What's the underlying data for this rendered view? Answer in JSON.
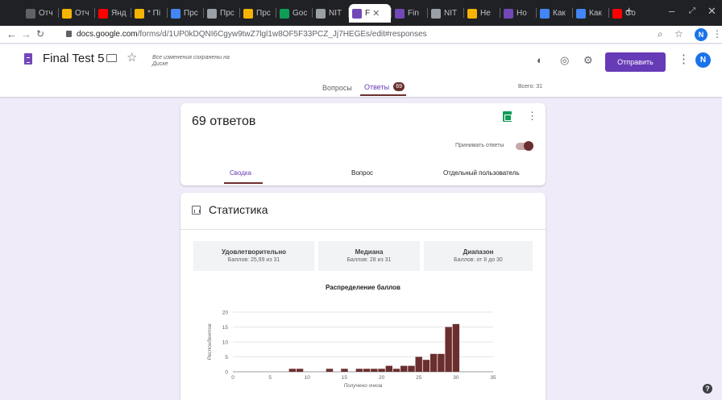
{
  "browser": {
    "tabs": [
      {
        "title": "Отч",
        "color": "#5f6368",
        "icon": "doc-icon"
      },
      {
        "title": "Отч",
        "color": "#f4b400",
        "icon": "slides-icon"
      },
      {
        "title": "Янд",
        "color": "#ff0000",
        "icon": "yandex-icon"
      },
      {
        "title": "* Пі",
        "color": "#f4b400",
        "icon": "mail-icon"
      },
      {
        "title": "Прс",
        "color": "#4285f4",
        "icon": "doc-icon"
      },
      {
        "title": "Прс",
        "color": "#9aa0a6",
        "icon": "app-icon"
      },
      {
        "title": "Прс",
        "color": "#f4b400",
        "icon": "slides-icon"
      },
      {
        "title": "Goc",
        "color": "#0f9d58",
        "icon": "sheets-icon"
      },
      {
        "title": "NIT",
        "color": "#9aa0a6",
        "icon": "classroom-icon"
      },
      {
        "title": "F",
        "color": "#7248b9",
        "icon": "forms-icon",
        "active": true
      },
      {
        "title": "Fin",
        "color": "#7248b9",
        "icon": "forms-icon"
      },
      {
        "title": "NIT",
        "color": "#9aa0a6",
        "icon": "classroom-icon"
      },
      {
        "title": "Не",
        "color": "#f4b400",
        "icon": "drive-icon"
      },
      {
        "title": "Ho",
        "color": "#7248b9",
        "icon": "forms-icon"
      },
      {
        "title": "Как",
        "color": "#4285f4",
        "icon": "google-icon"
      },
      {
        "title": "Как",
        "color": "#4285f4",
        "icon": "google-icon"
      },
      {
        "title": "Co",
        "color": "#ff0000",
        "icon": "youtube-icon"
      }
    ],
    "url_host": "docs.google.com",
    "url_path": "/forms/d/1UP0kDQNI6Cgyw9twZ7lgl1w8OF5F33PCZ_Jj7HEGEs/edit#responses",
    "profile_initial": "N"
  },
  "form": {
    "title": "Final Test 5",
    "saved_status": "Все изменения сохранены на Диске",
    "send_label": "Отправить",
    "avatar_initial": "N",
    "tab_questions": "Вопросы",
    "tab_responses": "Ответы",
    "responses_count": "69",
    "total_points": "Всего: 31"
  },
  "responses_card": {
    "title": "69 ответов",
    "accepting_label": "Принимать ответы",
    "accepting": true,
    "subtabs": [
      "Сводка",
      "Вопрос",
      "Отдельный пользователь"
    ]
  },
  "stats_card": {
    "title": "Статистика",
    "boxes": [
      {
        "label": "Удовлетворительно",
        "value": "Баллов: 25,99 из 31"
      },
      {
        "label": "Медиана",
        "value": "Баллов: 28 из 31"
      },
      {
        "label": "Диапазон",
        "value": "Баллов: от 8 до 30"
      }
    ],
    "chart_title": "Распределение баллов"
  },
  "chart_data": {
    "type": "bar",
    "title": "Распределение баллов",
    "xlabel": "Получено очков",
    "ylabel": "Респондентов",
    "xlim": [
      0,
      35
    ],
    "ylim": [
      0,
      20
    ],
    "xticks": [
      0,
      5,
      10,
      15,
      20,
      25,
      30,
      35
    ],
    "yticks": [
      0,
      5,
      10,
      15,
      20
    ],
    "x": [
      8,
      9,
      13,
      14,
      15,
      16,
      17,
      18,
      19,
      20,
      21,
      22,
      23,
      24,
      25,
      26,
      27,
      28,
      29,
      30
    ],
    "values": [
      1,
      1,
      1,
      0,
      1,
      0,
      1,
      1,
      1,
      1,
      2,
      1,
      2,
      2,
      5,
      4,
      6,
      6,
      15,
      16
    ],
    "color": "#6b2e2e",
    "grid": true
  },
  "colors": {
    "accent": "#673ab7",
    "theme": "#6b2e2e",
    "background": "#f0ebf8"
  }
}
